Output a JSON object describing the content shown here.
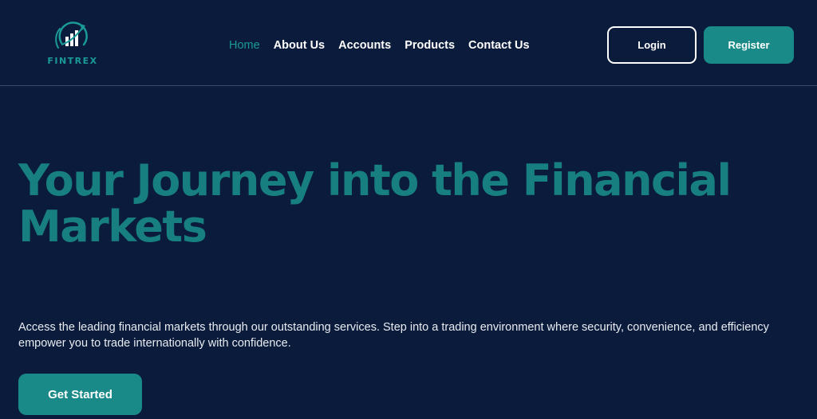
{
  "brand": {
    "name": "FINTREX",
    "logo_icon": "rising-bar-chart-icon",
    "accent_color": "#1a9a98",
    "background_color": "#0b1b3b"
  },
  "nav": {
    "items": [
      {
        "label": "Home",
        "active": true
      },
      {
        "label": "About Us",
        "active": false
      },
      {
        "label": "Accounts",
        "active": false
      },
      {
        "label": "Products",
        "active": false
      },
      {
        "label": "Contact Us",
        "active": false
      }
    ]
  },
  "header": {
    "login_label": "Login",
    "register_label": "Register"
  },
  "hero": {
    "title": "Your Journey into the Financial Markets",
    "description": "Access the leading financial markets through our outstanding services. Step into a trading environment where security, convenience, and efficiency empower you to trade internationally with confidence.",
    "cta_label": "Get Started"
  }
}
